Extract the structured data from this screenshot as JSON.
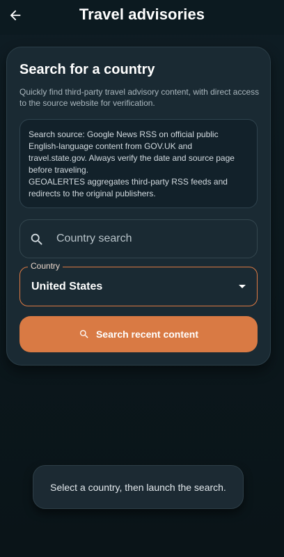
{
  "header": {
    "title": "Travel advisories",
    "back_icon": "arrow-left-icon"
  },
  "card": {
    "title": "Search for a country",
    "subtitle": "Quickly find third-party travel advisory content, with direct access to the source website for verification.",
    "source_info": {
      "line1": "Search source: Google News RSS on official public English-language content from GOV.UK and travel.state.gov. Always verify the date and source page before traveling.",
      "line2": "GEOALERTES aggregates third-party RSS feeds and redirects to the original publishers."
    },
    "search": {
      "placeholder": "Country search",
      "value": "",
      "icon": "search-icon"
    },
    "country_select": {
      "label": "Country",
      "value": "United States",
      "icon": "caret-down-icon"
    },
    "search_button": {
      "label": "Search recent content",
      "icon": "search-icon"
    }
  },
  "snackbar": {
    "message": "Select a country, then launch the search."
  },
  "colors": {
    "accent": "#d97a44",
    "background": "#0d1b21",
    "card": "#1a2a33",
    "select_border": "#e07b44"
  }
}
